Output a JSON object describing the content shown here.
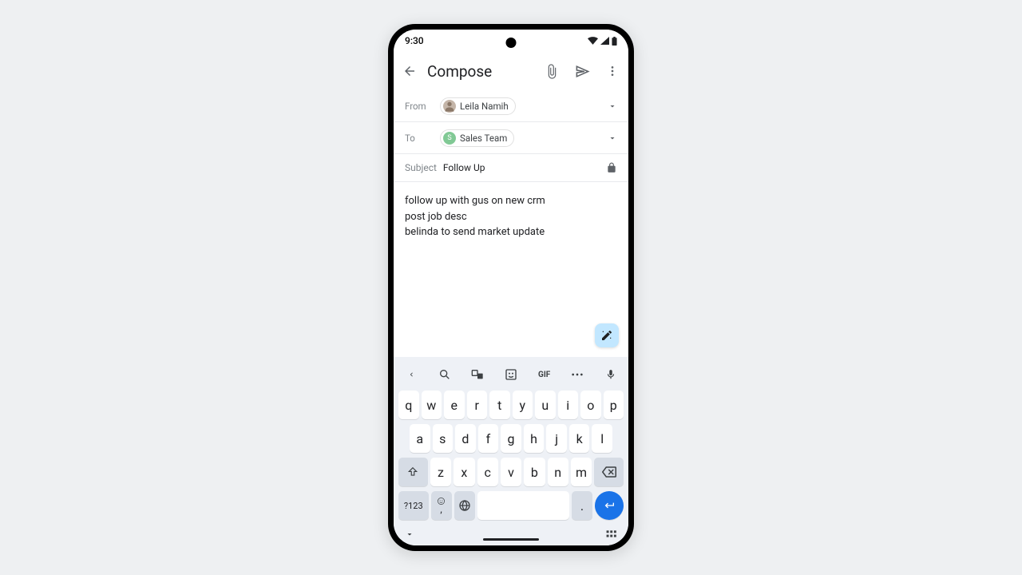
{
  "status": {
    "time": "9:30"
  },
  "appbar": {
    "title": "Compose"
  },
  "from": {
    "label": "From",
    "name": "Leila Namih",
    "avatar_color": "#c4b5a8"
  },
  "to": {
    "label": "To",
    "name": "Sales Team",
    "initial": "S",
    "avatar_color": "#81c995"
  },
  "subject": {
    "label": "Subject",
    "value": "Follow Up"
  },
  "body": {
    "line1": "follow up with gus on new crm",
    "line2": "post job desc",
    "line3": "belinda to send market update"
  },
  "keyboard": {
    "gif": "GIF",
    "row1": [
      "q",
      "w",
      "e",
      "r",
      "t",
      "y",
      "u",
      "i",
      "o",
      "p"
    ],
    "row2": [
      "a",
      "s",
      "d",
      "f",
      "g",
      "h",
      "j",
      "k",
      "l"
    ],
    "row3": [
      "z",
      "x",
      "c",
      "v",
      "b",
      "n",
      "m"
    ],
    "symbols": "?123",
    "comma": ",",
    "period": "."
  }
}
